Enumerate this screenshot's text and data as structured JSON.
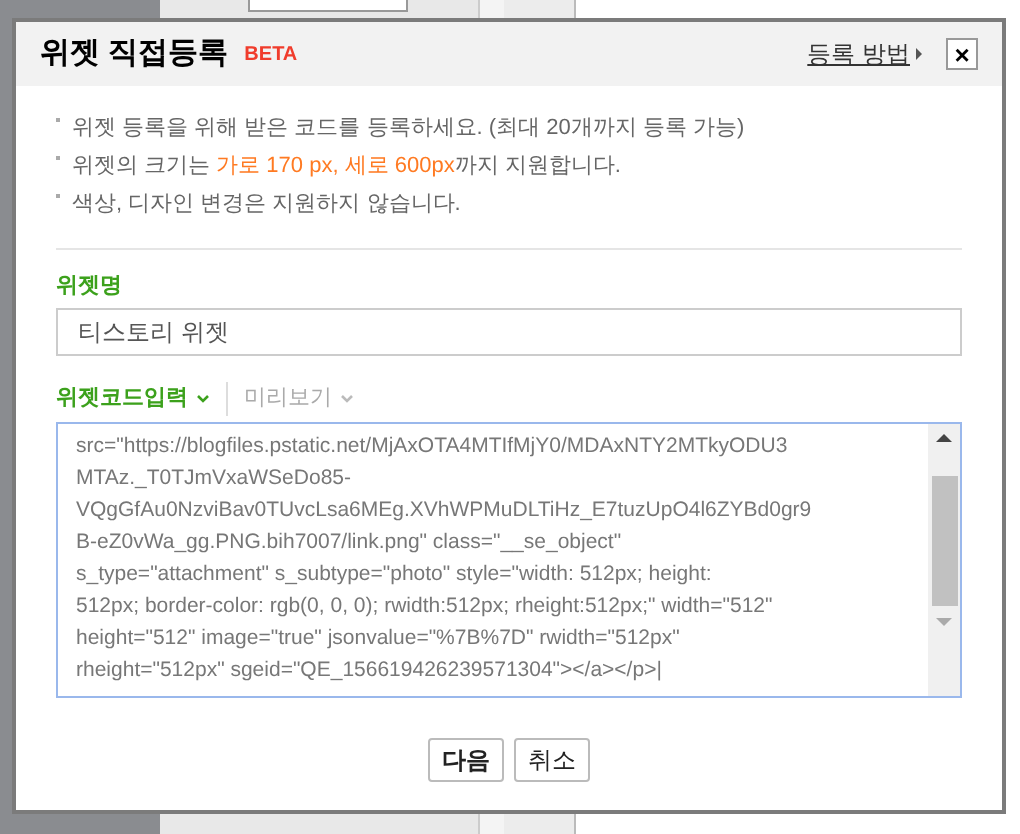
{
  "dialog": {
    "title": "위젯 직접등록",
    "badge": "BETA",
    "help_link": "등록 방법",
    "close": "×"
  },
  "notes": [
    {
      "text": "위젯 등록을 위해 받은 코드를 등록하세요. (최대 20개까지 등록 가능)"
    },
    {
      "text": "위젯의 크기는 ",
      "highlight": "가로 170 px, 세로 600px",
      "after": "까지 지원합니다."
    },
    {
      "text": "색상, 디자인 변경은 지원하지 않습니다."
    }
  ],
  "name_field": {
    "label": "위젯명",
    "value": "티스토리 위젯"
  },
  "code_tabs": [
    {
      "label": "위젯코드입력",
      "selected": true
    },
    {
      "label": "미리보기",
      "selected": false
    }
  ],
  "code_lines": [
    "src=\"https://blogfiles.pstatic.net/MjAxOTA4MTIfMjY0/MDAxNTY2MTkyODU3",
    "MTAz._T0TJmVxaWSeDo85-",
    "VQgGfAu0NzviBav0TUvcLsa6MEg.XVhWPMuDLTiHz_E7tuzUpO4l6ZYBd0gr9",
    "B-eZ0vWa_gg.PNG.bih7007/link.png\" class=\"__se_object\"",
    "s_type=\"attachment\" s_subtype=\"photo\" style=\"width: 512px; height:",
    "512px; border-color: rgb(0, 0, 0); rwidth:512px; rheight:512px;\" width=\"512\"",
    "height=\"512\" image=\"true\" jsonvalue=\"%7B%7D\" rwidth=\"512px\"",
    "rheight=\"512px\" sgeid=\"QE_156619426239571304\"></a></p>|"
  ],
  "buttons": [
    {
      "label": "다음",
      "kind": "primary"
    },
    {
      "label": "취소",
      "kind": "secondary"
    }
  ]
}
